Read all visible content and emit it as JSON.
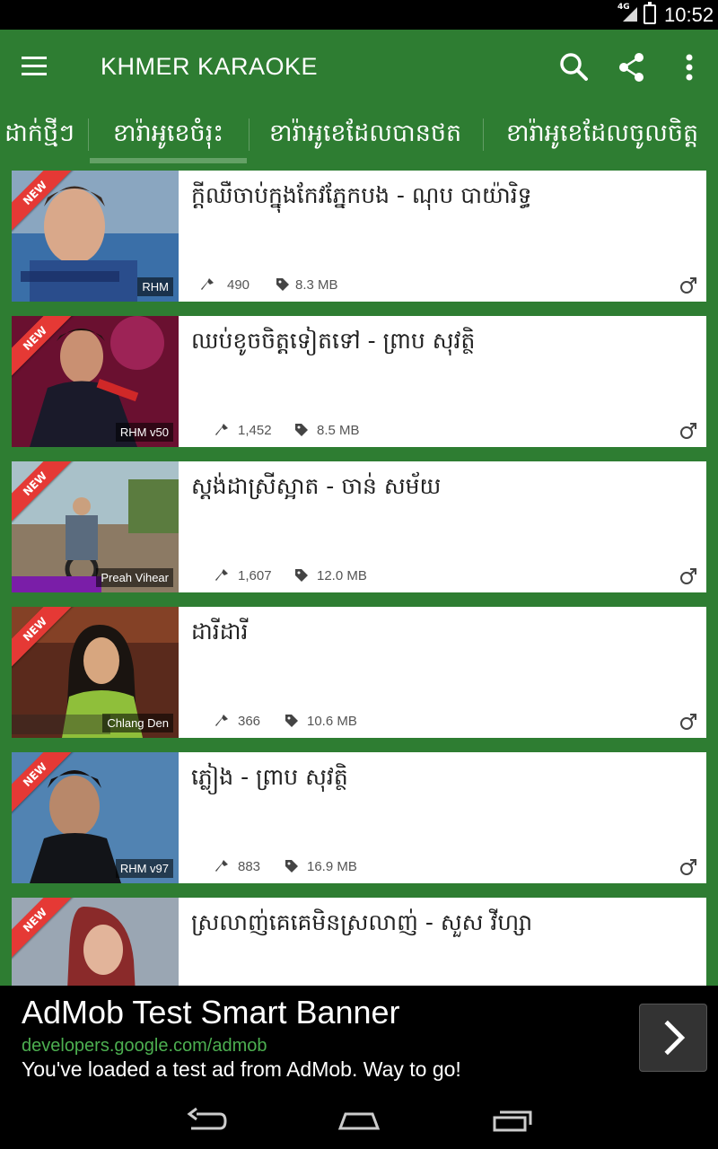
{
  "status": {
    "network": "4G",
    "time": "10:52"
  },
  "appbar": {
    "title": "KHMER KARAOKE",
    "icons": [
      "menu-icon",
      "search-icon",
      "share-icon",
      "more-icon"
    ]
  },
  "tabs": [
    {
      "label": "ដាក់ថ្មីៗ",
      "selected": false
    },
    {
      "label": "ខារ៉ាអូខេចំរុះ",
      "selected": true
    },
    {
      "label": "ខារ៉ាអូខេដែលបានថត",
      "selected": false
    },
    {
      "label": "ខារ៉ាអូខេដែលចូលចិត្ត",
      "selected": false
    }
  ],
  "songs": [
    {
      "title": "ក្តីឈឺចាប់ក្នុងកែវភ្នែកបង - ណុប បាយ៉ារិទ្ធ",
      "badge": "NEW",
      "source": "RHM",
      "plays": "490",
      "size": "8.3 MB"
    },
    {
      "title": "ឈប់ខូចចិត្តទៀតទៅ - ព្រាប សុវត្ថិ",
      "badge": "NEW",
      "source": "RHM v50",
      "plays": "1,452",
      "size": "8.5 MB"
    },
    {
      "title": "ស្តង់ដាស្រីស្អាត - ចាន់ សម័យ",
      "badge": "NEW",
      "source": "Preah Vihear",
      "plays": "1,607",
      "size": "12.0 MB"
    },
    {
      "title": "ដារីដារី",
      "badge": "NEW",
      "source": "Chlang Den",
      "plays": "366",
      "size": "10.6 MB"
    },
    {
      "title": "ភ្លៀង - ព្រាប សុវត្ថិ",
      "badge": "NEW",
      "source": "RHM v97",
      "plays": "883",
      "size": "16.9 MB"
    },
    {
      "title": "ស្រលាញ់គេគេមិនស្រលាញ់ - សួស វីហ្សា",
      "badge": "NEW",
      "source": "",
      "plays": "",
      "size": ""
    }
  ],
  "ad": {
    "headline": "AdMob Test Smart Banner",
    "url": "developers.google.com/admob",
    "text": "You've loaded a test ad from AdMob. Way to go!"
  },
  "colors": {
    "primary": "#2e7d32",
    "badge": "#e53935",
    "card": "#ffffff"
  }
}
